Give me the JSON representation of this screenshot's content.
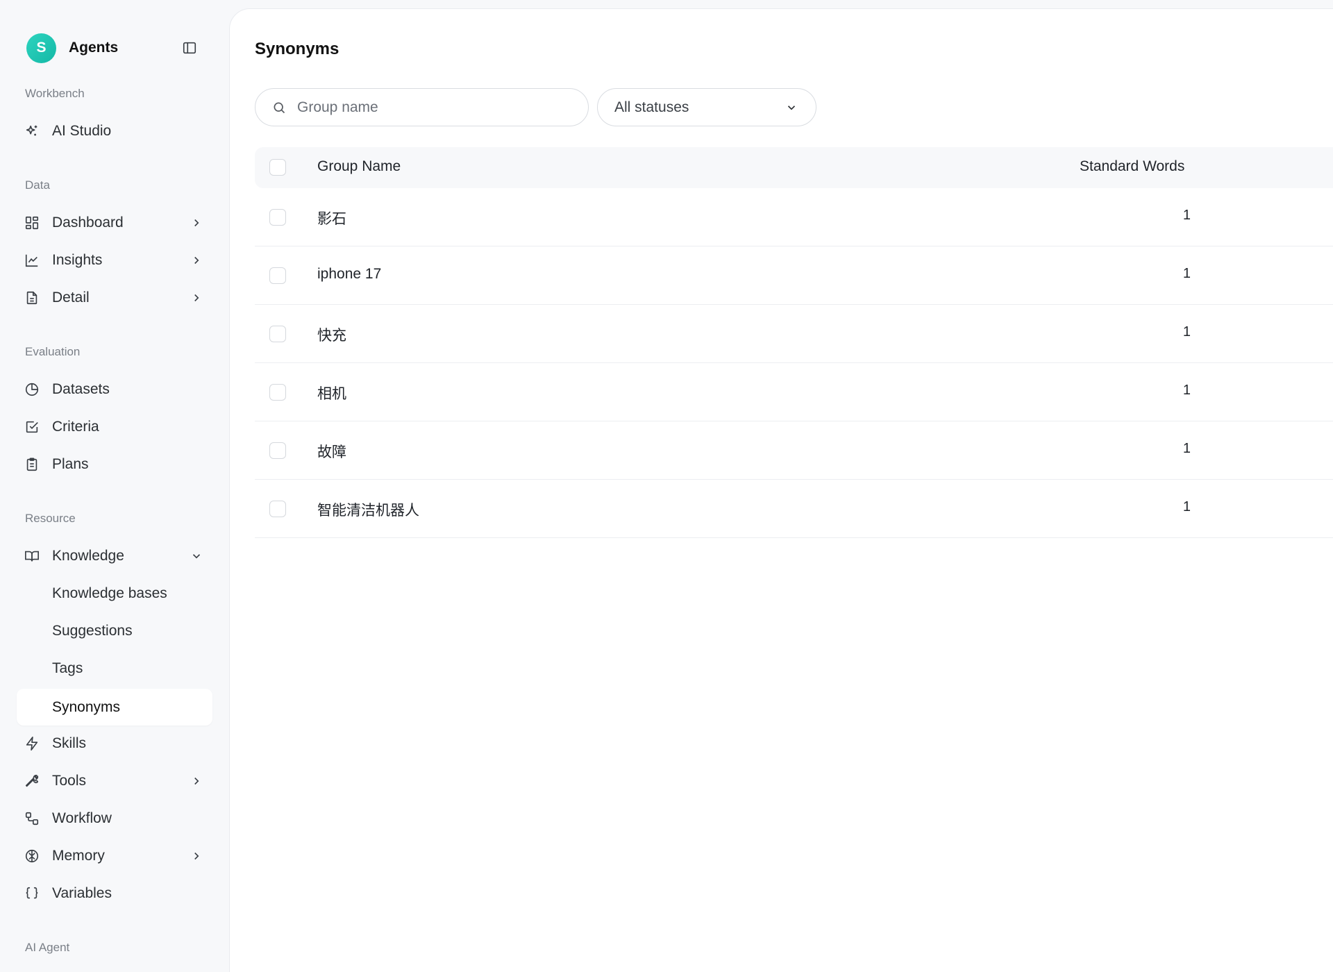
{
  "brand": {
    "initial": "S",
    "name": "Agents"
  },
  "sidebar": {
    "sections": {
      "workbench": "Workbench",
      "data": "Data",
      "evaluation": "Evaluation",
      "resource": "Resource",
      "ai_agent": "AI Agent"
    },
    "items": {
      "ai_studio": "AI Studio",
      "dashboard": "Dashboard",
      "insights": "Insights",
      "detail": "Detail",
      "datasets": "Datasets",
      "criteria": "Criteria",
      "plans": "Plans",
      "knowledge": "Knowledge",
      "knowledge_bases": "Knowledge bases",
      "suggestions": "Suggestions",
      "tags": "Tags",
      "synonyms": "Synonyms",
      "skills": "Skills",
      "tools": "Tools",
      "workflow": "Workflow",
      "memory": "Memory",
      "variables": "Variables"
    },
    "active": "synonyms"
  },
  "main": {
    "title": "Synonyms",
    "search": {
      "placeholder": "Group name",
      "value": ""
    },
    "status_filter": {
      "selected": "All statuses"
    },
    "table": {
      "columns": {
        "name": "Group Name",
        "standard": "Standard Words"
      },
      "rows": [
        {
          "name": "影石",
          "standard": "1"
        },
        {
          "name": "iphone 17",
          "standard": "1"
        },
        {
          "name": "快充",
          "standard": "1"
        },
        {
          "name": "相机",
          "standard": "1"
        },
        {
          "name": "故障",
          "standard": "1"
        },
        {
          "name": "智能清洁机器人",
          "standard": "1"
        }
      ]
    }
  }
}
